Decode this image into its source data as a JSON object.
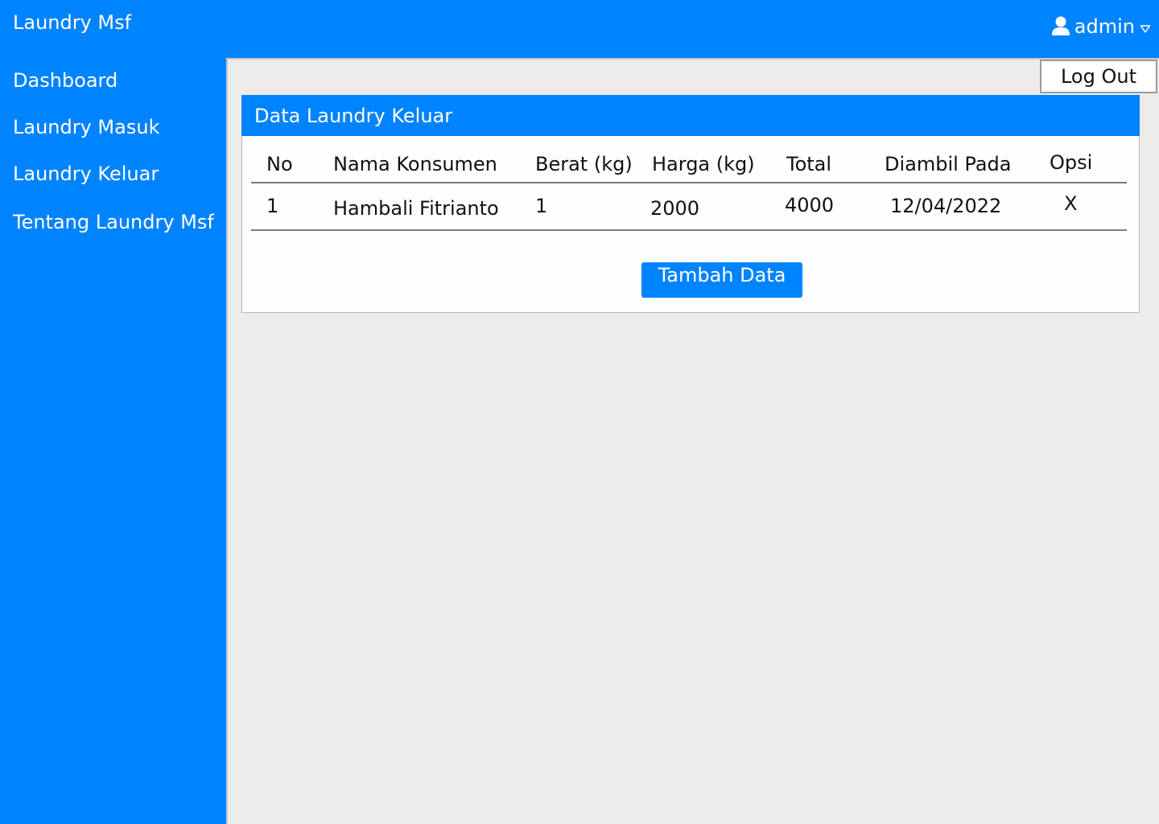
{
  "app": {
    "title": "Laundry Msf"
  },
  "user": {
    "name": "admin",
    "icon": "user-icon",
    "dropdown_icon": "caret-down-icon"
  },
  "sidebar": {
    "items": [
      {
        "label": "Dashboard"
      },
      {
        "label": "Laundry Masuk"
      },
      {
        "label": "Laundry Keluar"
      },
      {
        "label": "Tentang Laundry Msf"
      }
    ]
  },
  "actions": {
    "logout_label": "Log Out",
    "add_label": "Tambah Data"
  },
  "card": {
    "title": "Data Laundry Keluar"
  },
  "table": {
    "headers": [
      "No",
      "Nama Konsumen",
      "Berat (kg)",
      "Harga (kg)",
      "Total",
      "Diambil Pada",
      "Opsi"
    ],
    "rows": [
      [
        "1",
        "Hambali Fitrianto",
        "1",
        "2000",
        "4000",
        "12/04/2022",
        "X"
      ]
    ]
  },
  "colors": {
    "primary": "#0083ff",
    "content_bg": "#edecea",
    "card_bg": "#fefefe",
    "text": "#111111"
  }
}
